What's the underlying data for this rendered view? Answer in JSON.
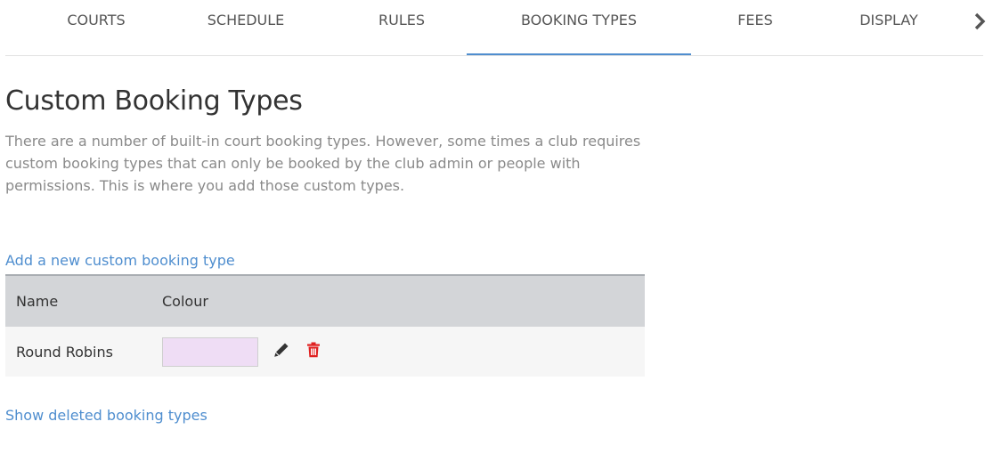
{
  "tabs": [
    {
      "label": "COURTS",
      "active": false
    },
    {
      "label": "SCHEDULE",
      "active": false
    },
    {
      "label": "RULES",
      "active": false
    },
    {
      "label": "BOOKING TYPES",
      "active": true
    },
    {
      "label": "FEES",
      "active": false
    },
    {
      "label": "DISPLAY",
      "active": false
    }
  ],
  "tab_next_icon": "chevron-right-icon",
  "page": {
    "title": "Custom Booking Types",
    "description": "There are a number of built-in court booking types. However, some times a club requires custom booking types that can only be booked by the club admin or people with permissions. This is where you add those custom types.",
    "add_link": "Add a new custom booking type",
    "show_deleted_link": "Show deleted booking types"
  },
  "table": {
    "headers": {
      "name": "Name",
      "colour": "Colour"
    },
    "rows": [
      {
        "name": "Round Robins",
        "colour": "#efddf5",
        "edit_icon": "pencil-icon",
        "delete_icon": "trash-icon"
      }
    ]
  },
  "colors": {
    "accent": "#4f8ecf",
    "delete": "#e02020",
    "header_bg": "#d3d5d8"
  }
}
